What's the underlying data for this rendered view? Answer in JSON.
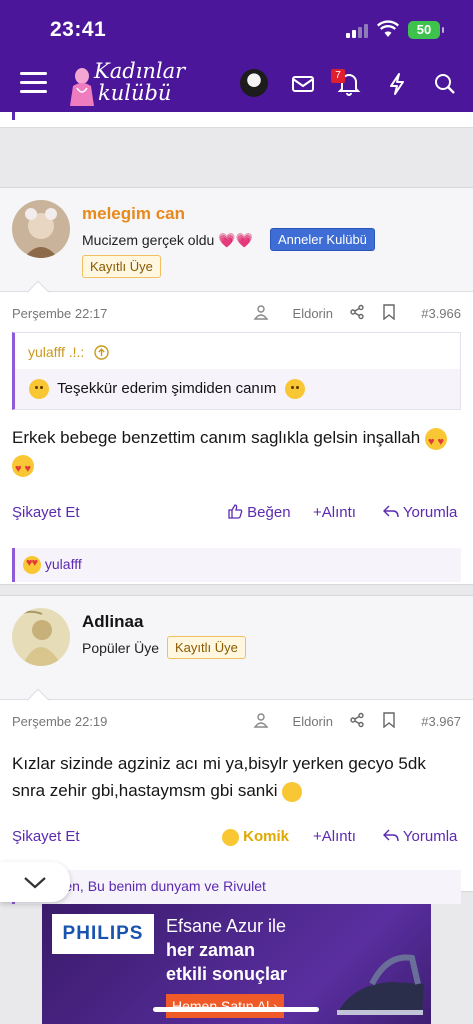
{
  "status_bar": {
    "time": "23:41",
    "battery": "50"
  },
  "nav": {
    "logo_line1": "Kadınlar",
    "logo_line2": "kulübü",
    "notification_count": "7"
  },
  "posts": [
    {
      "username": "melegim can",
      "user_title": "Mucizem gerçek oldu 💗💗",
      "group_badge": "Anneler Kulübü",
      "member_badge": "Kayıtlı Üye",
      "date": "Perşembe 22:17",
      "editor": "Eldorin",
      "post_number": "#3.966",
      "quote_author": "yulafff .!.:",
      "quote_text": "Teşekkür ederim şimdiden canım",
      "body": "Erkek bebege benzettim canım saglıkla gelsin inşallah",
      "report": "Şikayet Et",
      "like": "Beğen",
      "quote_action": "Alıntı",
      "reply": "Yorumla",
      "reactions": "yulafff"
    },
    {
      "username": "Adlinaa",
      "user_title": "Popüler Üye",
      "member_badge": "Kayıtlı Üye",
      "date": "Perşembe 22:19",
      "editor": "Eldorin",
      "post_number": "#3.967",
      "body": "Kızlar sizinde agziniz acı mi ya,bisylr yerken gecyo 5dk snra zehir gbi,hastaymsm gbi sanki",
      "report": "Şikayet Et",
      "reaction_label": "Komik",
      "quote_action": "Alıntı",
      "reply": "Yorumla",
      "reactions": "Sen, Bu benim dunyam ve Rivulet"
    }
  ],
  "ad": {
    "brand": "PHILIPS",
    "line1": "Efsane Azur ile",
    "line2": "her zaman",
    "line3": "etkili sonuçlar",
    "cta": "Hemen Satın Al ›"
  },
  "colors": {
    "header": "#4b169a",
    "accent": "#5b2ab0",
    "username_orange": "#e8891b"
  }
}
